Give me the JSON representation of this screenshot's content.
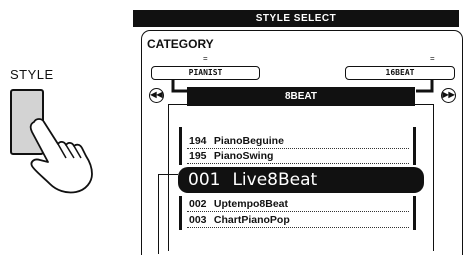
{
  "left_control": {
    "style_label": "STYLE",
    "hand_icon": "pointing-hand-icon"
  },
  "panel": {
    "title": "STYLE SELECT",
    "category_label": "CATEGORY",
    "prev_category": "PIANIST",
    "next_category": "16BEAT",
    "current_category": "8BEAT",
    "prev_arrow_icon": "rewind-icon",
    "next_arrow_icon": "fast-forward-icon"
  },
  "style_list": {
    "above": [
      {
        "number": "194",
        "name": "PianoBeguine"
      },
      {
        "number": "195",
        "name": "PianoSwing"
      }
    ],
    "selected": {
      "number": "001",
      "name": "Live8Beat"
    },
    "below": [
      {
        "number": "002",
        "name": "Uptempo8Beat"
      },
      {
        "number": "003",
        "name": "ChartPianoPop"
      }
    ]
  }
}
